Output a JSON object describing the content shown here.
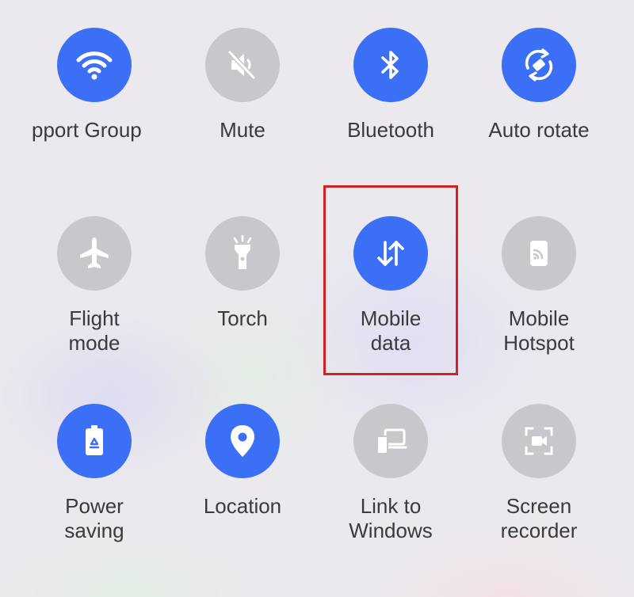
{
  "tiles": [
    {
      "label": "pport Group",
      "icon": "wifi-icon",
      "state": "on"
    },
    {
      "label": "Mute",
      "icon": "mute-icon",
      "state": "off"
    },
    {
      "label": "Bluetooth",
      "icon": "bluetooth-icon",
      "state": "on"
    },
    {
      "label": "Auto rotate",
      "icon": "auto-rotate-icon",
      "state": "on"
    },
    {
      "label": "Flight\nmode",
      "icon": "airplane-icon",
      "state": "off"
    },
    {
      "label": "Torch",
      "icon": "torch-icon",
      "state": "off"
    },
    {
      "label": "Mobile\ndata",
      "icon": "mobile-data-icon",
      "state": "on"
    },
    {
      "label": "Mobile\nHotspot",
      "icon": "hotspot-icon",
      "state": "off"
    },
    {
      "label": "Power\nsaving",
      "icon": "power-saving-icon",
      "state": "on"
    },
    {
      "label": "Location",
      "icon": "location-icon",
      "state": "on"
    },
    {
      "label": "Link to\nWindows",
      "icon": "link-to-windows-icon",
      "state": "off"
    },
    {
      "label": "Screen\nrecorder",
      "icon": "screen-recorder-icon",
      "state": "off"
    }
  ],
  "colors": {
    "active": "#3b6ff5",
    "inactive": "#c9c7cc",
    "highlight_border": "#d32020",
    "background": "#ebe9ee"
  }
}
